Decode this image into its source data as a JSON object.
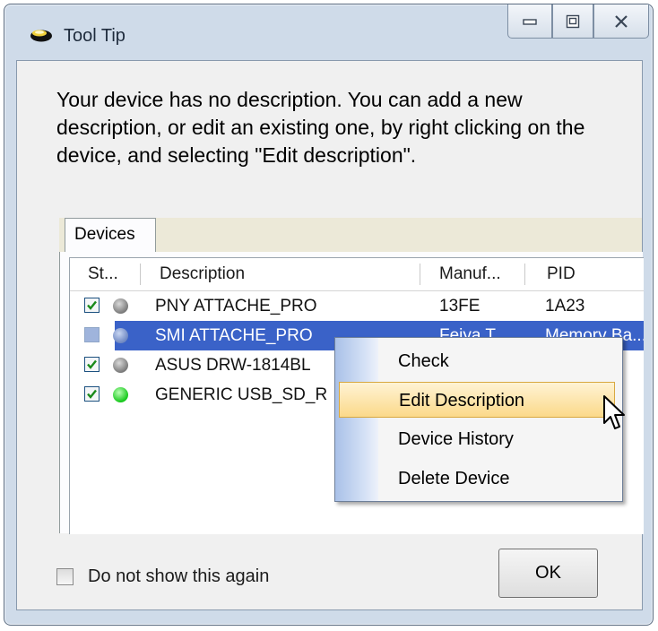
{
  "window": {
    "title": "Tool Tip"
  },
  "message": "Your device has no description. You can add a new description, or edit an existing one, by right clicking on the device, and selecting \"Edit description\".",
  "tabs": [
    {
      "label": "Devices"
    }
  ],
  "device_list": {
    "columns": [
      "St...",
      "Description",
      "Manuf...",
      "PID"
    ],
    "rows": [
      {
        "checked": true,
        "status": "gray",
        "description": "PNY ATTACHE_PRO",
        "manufacturer": "13FE",
        "pid": "1A23",
        "selected": false
      },
      {
        "checked": false,
        "status": "gray",
        "description": "SMI ATTACHE_PRO",
        "manufacturer": "Feiya T...",
        "pid": "Memory Ba...",
        "selected": true
      },
      {
        "checked": true,
        "status": "gray",
        "description": "ASUS DRW-1814BL",
        "manufacturer": "",
        "pid": "",
        "selected": false
      },
      {
        "checked": true,
        "status": "green",
        "description": "GENERIC USB_SD_R",
        "manufacturer": "",
        "pid": "",
        "selected": false
      }
    ]
  },
  "context_menu": {
    "items": [
      {
        "label": "Check",
        "highlighted": false
      },
      {
        "label": "Edit Description",
        "highlighted": true
      },
      {
        "label": "Device History",
        "highlighted": false
      },
      {
        "label": "Delete Device",
        "highlighted": false
      }
    ]
  },
  "footer": {
    "dont_show_label": "Do not show this again",
    "dont_show_checked": false,
    "ok_label": "OK"
  },
  "colors": {
    "selection": "#3a62c8",
    "menu_highlight": "#fbd98a",
    "status_green": "#16c81b"
  }
}
